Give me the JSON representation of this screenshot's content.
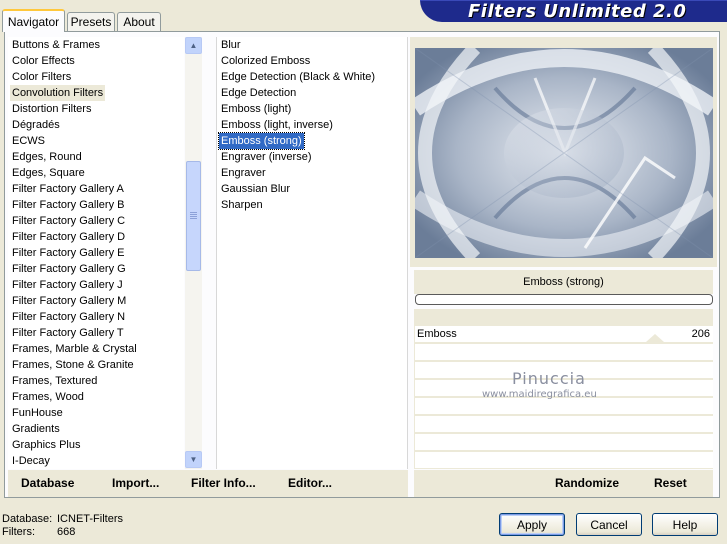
{
  "tabs": [
    "Navigator",
    "Presets",
    "About"
  ],
  "banner_title": "Filters Unlimited 2.0",
  "categories": [
    "Buttons & Frames",
    "Color Effects",
    "Color Filters",
    "Convolution Filters",
    "Distortion Filters",
    "Dégradés",
    "ECWS",
    "Edges, Round",
    "Edges, Square",
    "Filter Factory Gallery A",
    "Filter Factory Gallery B",
    "Filter Factory Gallery C",
    "Filter Factory Gallery D",
    "Filter Factory Gallery E",
    "Filter Factory Gallery G",
    "Filter Factory Gallery J",
    "Filter Factory Gallery M",
    "Filter Factory Gallery N",
    "Filter Factory Gallery T",
    "Frames, Marble & Crystal",
    "Frames, Stone & Granite",
    "Frames, Textured",
    "Frames, Wood",
    "FunHouse",
    "Gradients",
    "Graphics Plus",
    "I-Decay"
  ],
  "selected_category": "Convolution Filters",
  "filters": [
    "Blur",
    "Colorized Emboss",
    "Edge Detection (Black & White)",
    "Edge Detection",
    "Emboss (light)",
    "Emboss (light, inverse)",
    "Emboss (strong)",
    "Engraver (inverse)",
    "Engraver",
    "Gaussian Blur",
    "Sharpen"
  ],
  "selected_filter": "Emboss (strong)",
  "preview_filter_name": "Emboss (strong)",
  "progress": 0,
  "params": [
    {
      "label": "Emboss",
      "value": "206"
    }
  ],
  "watermark": {
    "name": "Pinuccia",
    "url": "www.maidiregrafica.eu"
  },
  "left_actions": {
    "database": "Database",
    "import": "Import...",
    "filter_info": "Filter Info...",
    "editor": "Editor..."
  },
  "right_actions": {
    "randomize": "Randomize",
    "reset": "Reset"
  },
  "footer": {
    "database_label": "Database:",
    "database_value": "ICNET-Filters",
    "filters_label": "Filters:",
    "filters_value": "668"
  },
  "buttons": {
    "apply": "Apply",
    "cancel": "Cancel",
    "help": "Help"
  },
  "colors": {
    "banner": "#1e2a8c",
    "selection": "#316ac5",
    "window_bg": "#ece9d8",
    "tab_highlight": "#ffc83c"
  }
}
